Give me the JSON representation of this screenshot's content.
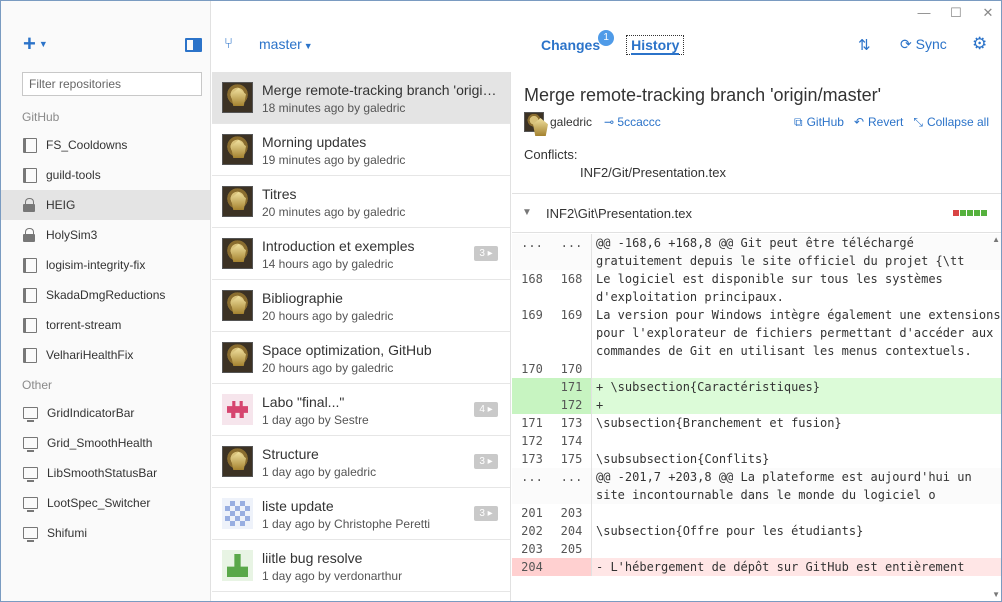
{
  "window": {
    "minimize": "—",
    "maximize": "☐",
    "close": "✕"
  },
  "sidebar": {
    "add_label": "+",
    "filter_placeholder": "Filter repositories",
    "sections": [
      {
        "title": "GitHub"
      },
      {
        "title": "Other"
      }
    ],
    "github_repos": [
      {
        "name": "FS_Cooldowns",
        "icon": "book-icon"
      },
      {
        "name": "guild-tools",
        "icon": "book-icon"
      },
      {
        "name": "HEIG",
        "icon": "lock-icon",
        "selected": true
      },
      {
        "name": "HolySim3",
        "icon": "lock-icon"
      },
      {
        "name": "logisim-integrity-fix",
        "icon": "book-icon"
      },
      {
        "name": "SkadaDmgReductions",
        "icon": "book-icon"
      },
      {
        "name": "torrent-stream",
        "icon": "book-icon"
      },
      {
        "name": "VelhariHealthFix",
        "icon": "book-icon"
      }
    ],
    "other_repos": [
      {
        "name": "GridIndicatorBar",
        "icon": "monitor-icon"
      },
      {
        "name": "Grid_SmoothHealth",
        "icon": "monitor-icon"
      },
      {
        "name": "LibSmoothStatusBar",
        "icon": "monitor-icon"
      },
      {
        "name": "LootSpec_Switcher",
        "icon": "monitor-icon"
      },
      {
        "name": "Shifumi",
        "icon": "monitor-icon"
      }
    ]
  },
  "branch": {
    "name": "master"
  },
  "tabs": {
    "changes": "Changes",
    "changes_count": "1",
    "history": "History"
  },
  "toolbar": {
    "sync": "Sync"
  },
  "commits": [
    {
      "title": "Merge remote-tracking branch 'origin/master'",
      "meta": "18 minutes ago by galedric",
      "avatar": "knight",
      "selected": true
    },
    {
      "title": "Morning updates",
      "meta": "19 minutes ago by galedric",
      "avatar": "knight"
    },
    {
      "title": "Titres",
      "meta": "20 minutes ago by galedric",
      "avatar": "knight"
    },
    {
      "title": "Introduction et exemples",
      "meta": "14 hours ago by galedric",
      "avatar": "knight",
      "badge": "3 ▸"
    },
    {
      "title": "Bibliographie",
      "meta": "20 hours ago by galedric",
      "avatar": "knight"
    },
    {
      "title": "Space optimization, GitHub",
      "meta": "20 hours ago by galedric",
      "avatar": "knight"
    },
    {
      "title": "Labo \"final...\"",
      "meta": "1 day ago by Sestre",
      "avatar": "pink",
      "badge": "4 ▸"
    },
    {
      "title": "Structure",
      "meta": "1 day ago by galedric",
      "avatar": "knight",
      "badge": "3 ▸"
    },
    {
      "title": "liste update",
      "meta": "1 day ago by Christophe Peretti",
      "avatar": "blue",
      "badge": "3 ▸"
    },
    {
      "title": "liitle bug resolve",
      "meta": "1 day ago by verdonarthur",
      "avatar": "green"
    }
  ],
  "detail": {
    "title": "Merge remote-tracking branch 'origin/master'",
    "author": "galedric",
    "sha": "5ccaccc",
    "actions": {
      "github": "GitHub",
      "revert": "Revert",
      "collapse": "Collapse all"
    },
    "conflicts_label": "Conflicts:",
    "conflict_file": "INF2/Git/Presentation.tex",
    "file_name": "INF2\\Git\\Presentation.tex",
    "file_stats": [
      "#d94444",
      "#55b13d",
      "#55b13d",
      "#55b13d",
      "#55b13d"
    ]
  },
  "diff": [
    {
      "type": "hunk",
      "old": "...",
      "new": "...",
      "text": "@@ -168,6 +168,8 @@ Git peut être téléchargé gratuitement depuis le site officiel du projet {\\tt"
    },
    {
      "type": "ctx",
      "old": "168",
      "new": "168",
      "text": "Le logiciel est disponible sur tous les systèmes d'exploitation principaux."
    },
    {
      "type": "ctx",
      "old": "169",
      "new": "169",
      "text": "La version pour Windows intègre également une extensions pour l'explorateur de fichiers permettant d'accéder aux commandes de Git en utilisant les menus contextuels."
    },
    {
      "type": "ctx",
      "old": "170",
      "new": "170",
      "text": ""
    },
    {
      "type": "add",
      "old": "",
      "new": "171",
      "text": "+ \\subsection{Caractéristiques}"
    },
    {
      "type": "add",
      "old": "",
      "new": "172",
      "text": "+"
    },
    {
      "type": "ctx",
      "old": "171",
      "new": "173",
      "text": "\\subsection{Branchement et fusion}"
    },
    {
      "type": "ctx",
      "old": "172",
      "new": "174",
      "text": ""
    },
    {
      "type": "ctx",
      "old": "173",
      "new": "175",
      "text": "\\subsubsection{Conflits}"
    },
    {
      "type": "hunk",
      "old": "...",
      "new": "...",
      "text": "@@ -201,7 +203,8 @@ La plateforme est aujourd'hui un site incontournable dans le monde du logiciel o"
    },
    {
      "type": "ctx",
      "old": "201",
      "new": "203",
      "text": ""
    },
    {
      "type": "ctx",
      "old": "202",
      "new": "204",
      "text": "\\subsection{Offre pour les étudiants}"
    },
    {
      "type": "ctx",
      "old": "203",
      "new": "205",
      "text": ""
    },
    {
      "type": "del",
      "old": "204",
      "new": "",
      "text": "- L'hébergement de dépôt sur GitHub est entièrement"
    }
  ]
}
